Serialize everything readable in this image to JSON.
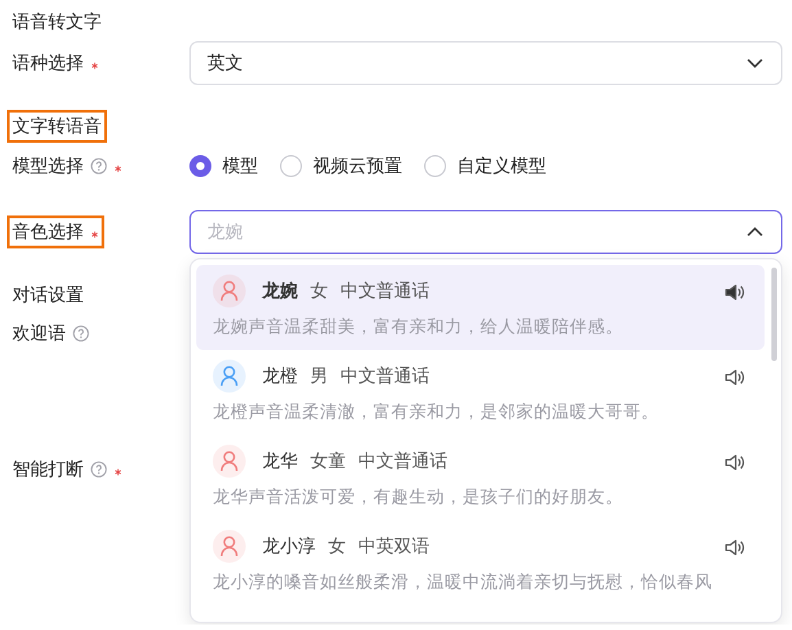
{
  "rows": [
    {
      "kind": "heading",
      "text": "语音转文字",
      "highlighted": false
    },
    {
      "kind": "select",
      "label": "语种选择",
      "required": true,
      "help": false,
      "highlighted": false,
      "value": "英文",
      "open": false
    },
    {
      "kind": "heading",
      "text": "文字转语音",
      "highlighted": true
    },
    {
      "kind": "radio",
      "label": "模型选择",
      "required": true,
      "help": true,
      "highlighted": false,
      "options": [
        {
          "label": "模型",
          "selected": true
        },
        {
          "label": "视频云预置",
          "selected": false
        },
        {
          "label": "自定义模型",
          "selected": false
        }
      ]
    },
    {
      "kind": "select",
      "label": "音色选择",
      "required": true,
      "help": false,
      "highlighted": true,
      "placeholder": "龙婉",
      "open": true,
      "voices": [
        {
          "name": "龙婉",
          "gender": "女",
          "language": "中文普通话",
          "description": "龙婉声音温柔甜美，富有亲和力，给人温暖陪伴感。",
          "color": "#f07c7c",
          "selected": true
        },
        {
          "name": "龙橙",
          "gender": "男",
          "language": "中文普通话",
          "description": "龙橙声音温柔清澈，富有亲和力，是邻家的温暖大哥哥。",
          "color": "#4a9ff5",
          "selected": false
        },
        {
          "name": "龙华",
          "gender": "女童",
          "language": "中文普通话",
          "description": "龙华声音活泼可爱，有趣生动，是孩子们的好朋友。",
          "color": "#f07c7c",
          "selected": false
        },
        {
          "name": "龙小淳",
          "gender": "女",
          "language": "中英双语",
          "description": "龙小淳的嗓音如丝般柔滑，温暖中流淌着亲切与抚慰，恰似春风",
          "color": "#f07c7c",
          "selected": false
        }
      ]
    },
    {
      "kind": "heading",
      "text": "对话设置",
      "highlighted": false
    },
    {
      "kind": "field",
      "label": "欢迎语",
      "required": false,
      "help": true,
      "highlighted": false
    },
    {
      "kind": "field",
      "label": "智能打断",
      "required": true,
      "help": true,
      "highlighted": false
    }
  ]
}
